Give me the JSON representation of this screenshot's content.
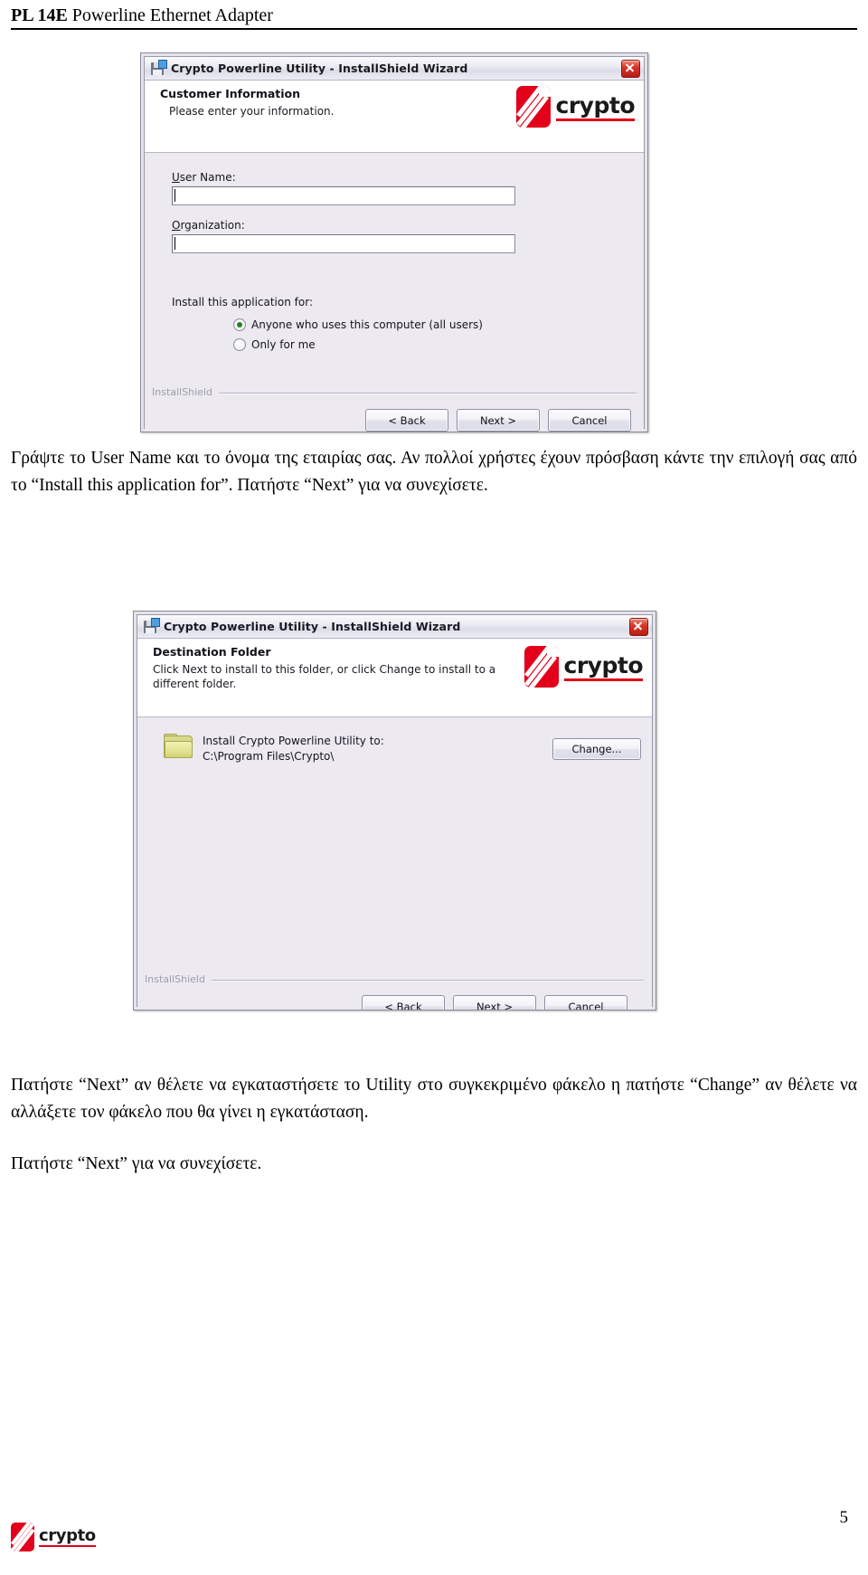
{
  "page_header": {
    "title_bold": "PL 14E",
    "title_rest": " Powerline Ethernet Adapter"
  },
  "dialog1": {
    "titlebar": {
      "title": "Crypto Powerline Utility - InstallShield Wizard",
      "icon": "installer-disk-icon",
      "close_label": "×"
    },
    "header": {
      "title": "Customer Information",
      "subtitle": "Please enter your information."
    },
    "logo": {
      "wordmark": "crypto",
      "mark_color": "#e2001a"
    },
    "fields": [
      {
        "label_accel": "U",
        "label_rest": "ser Name:",
        "value": "",
        "placeholder": ""
      },
      {
        "label_accel": "O",
        "label_rest": "rganization:",
        "value": "",
        "placeholder": ""
      }
    ],
    "group": {
      "label": "Install this application for:",
      "options": [
        {
          "label": "Anyone who uses this computer (all users)",
          "selected": true
        },
        {
          "label": "Only for me",
          "selected": false
        }
      ]
    },
    "footer": {
      "brand": "InstallShield",
      "buttons": [
        {
          "label": "< Back"
        },
        {
          "label": "Next >"
        },
        {
          "label": "Cancel"
        }
      ]
    }
  },
  "paragraph1": "Γράψτε το User Name και το όνομα της εταιρίας σας. Αν πολλοί χρήστες έχουν πρόσβαση κάντε την επιλογή σας από το “Install this application for”. Πατήστε “Next” για να συνεχίσετε.",
  "dialog2": {
    "titlebar": {
      "title": "Crypto Powerline Utility - InstallShield Wizard",
      "icon": "installer-disk-icon",
      "close_label": "×"
    },
    "header": {
      "title": "Destination Folder",
      "subtitle": "Click Next to install to this folder, or click Change to install to a different folder."
    },
    "logo": {
      "wordmark": "crypto",
      "mark_color": "#e2001a"
    },
    "destination": {
      "icon": "folder-icon",
      "line1": "Install Crypto Powerline Utility to:",
      "line2": "C:\\Program Files\\Crypto\\",
      "change_button": "Change..."
    },
    "footer": {
      "brand": "InstallShield",
      "buttons": [
        {
          "label": "< Back"
        },
        {
          "label": "Next >"
        },
        {
          "label": "Cancel"
        }
      ]
    }
  },
  "paragraph2": "Πατήστε “Next” αν θέλετε να εγκαταστήσετε το Utility στο συγκεκριμένο φάκελο η πατήστε “Change” αν θέλετε να αλλάξετε τον φάκελο που θα γίνει η εγκατάσταση.",
  "paragraph3": "Πατήστε “Next” για να συνεχίσετε.",
  "page_footer": {
    "wordmark": "crypto",
    "page_number": "5"
  }
}
